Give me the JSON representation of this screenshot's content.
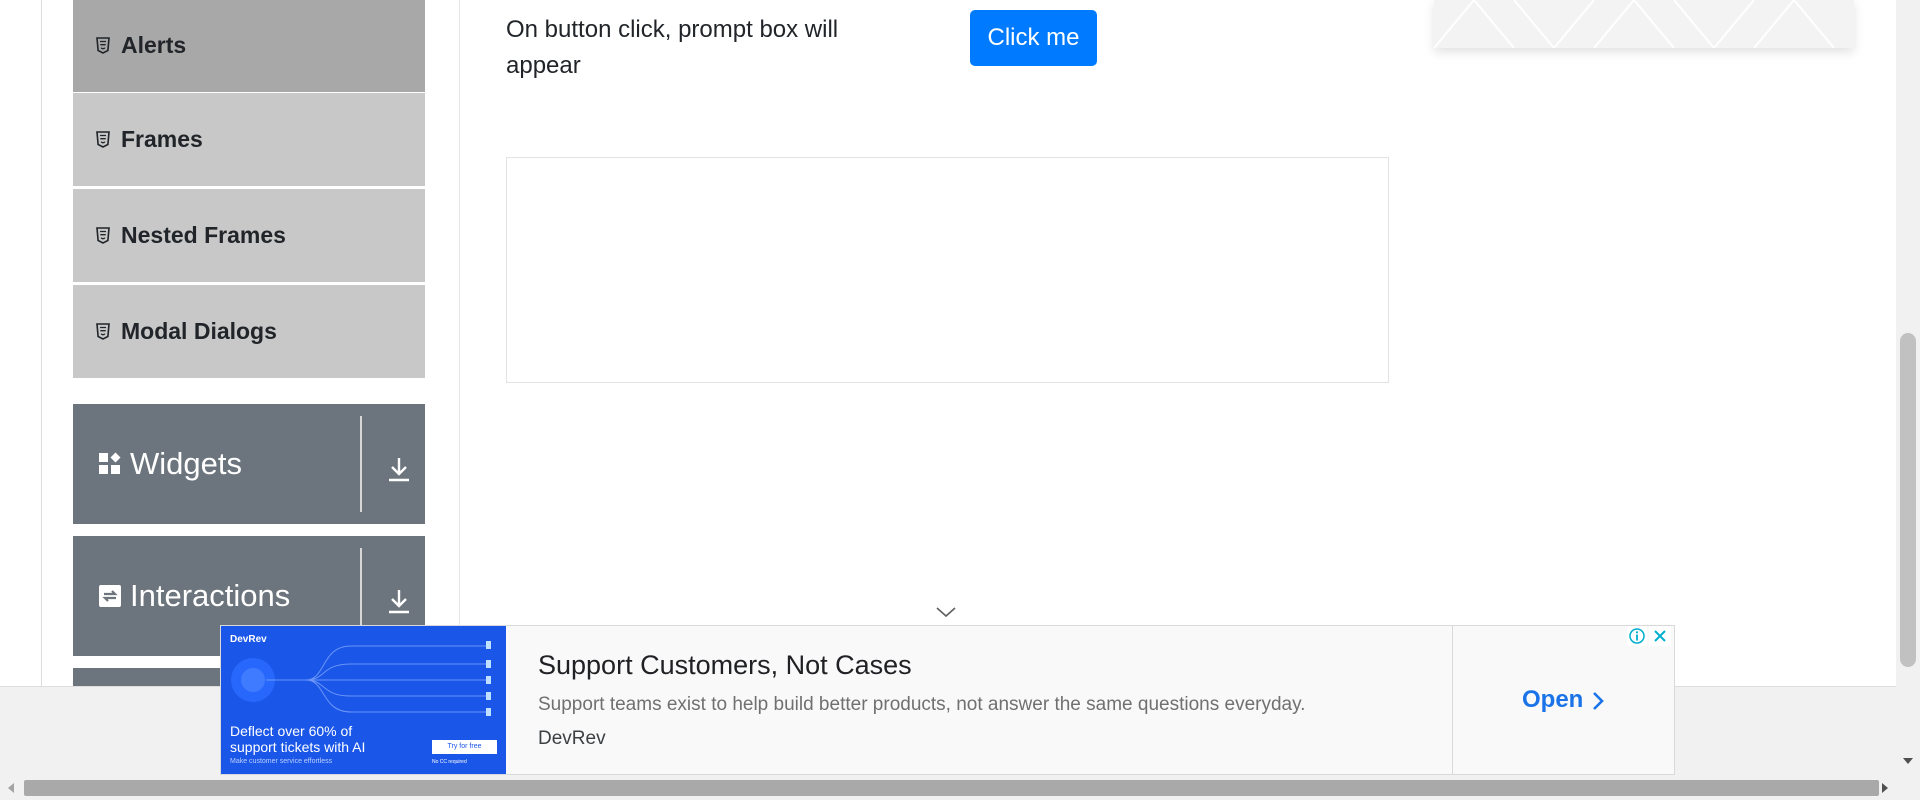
{
  "sidebar": {
    "items": [
      {
        "label": "Alerts",
        "icon": "html5-shield-icon",
        "active": true
      },
      {
        "label": "Frames",
        "icon": "html5-shield-icon",
        "active": false
      },
      {
        "label": "Nested Frames",
        "icon": "html5-shield-icon",
        "active": false
      },
      {
        "label": "Modal Dialogs",
        "icon": "html5-shield-icon",
        "active": false
      }
    ],
    "groups": [
      {
        "label": "Widgets",
        "icon": "widgets-icon",
        "expand_icon": "download-arrow-icon"
      },
      {
        "label": "Interactions",
        "icon": "swap-icon",
        "expand_icon": "download-arrow-icon"
      }
    ]
  },
  "main": {
    "prompt_text": "On button click, prompt box will appear",
    "button_label": "Click me"
  },
  "ad": {
    "image": {
      "brand": "DevRev",
      "hook": "Deflect over 60% of support tickets with AI",
      "subhook": "Make customer service effortless",
      "cta": "Try for free",
      "note": "No CC required"
    },
    "headline": "Support Customers, Not Cases",
    "description": "Support teams exist to help build better products, not answer the same questions everyday.",
    "advertiser": "DevRev",
    "open_label": "Open"
  },
  "colors": {
    "primary": "#007bff",
    "sidebar_group": "#6c757d",
    "sidebar_item": "#c8c8c8",
    "sidebar_item_active": "#a8a8a8",
    "ad_link": "#1a73e8",
    "ad_image_bg": "#1a56e8"
  }
}
